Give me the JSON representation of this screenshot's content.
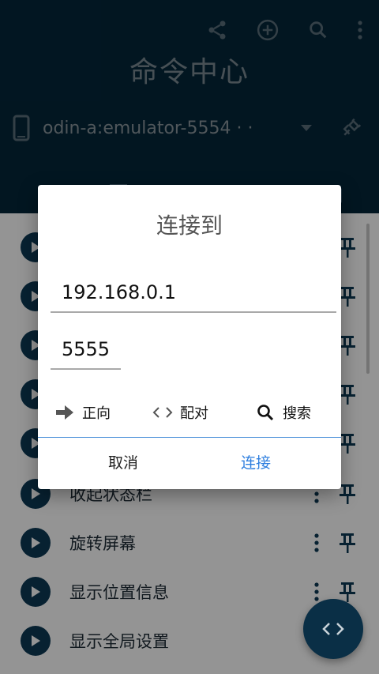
{
  "app": {
    "title": "命令中心",
    "device_name": "odin-a:emulator-5554 · ·"
  },
  "commands": [
    {
      "label": ""
    },
    {
      "label": ""
    },
    {
      "label": ""
    },
    {
      "label": ""
    },
    {
      "label": ""
    },
    {
      "label": "收起状态栏"
    },
    {
      "label": "旋转屏幕"
    },
    {
      "label": "显示位置信息"
    },
    {
      "label": "显示全局设置"
    }
  ],
  "dialog": {
    "title": "连接到",
    "ip_value": "192.168.0.1",
    "port_value": "5555",
    "option_forward": "正向",
    "option_pair": "配对",
    "option_search": "搜索",
    "cancel_label": "取消",
    "connect_label": "连接"
  },
  "colors": {
    "appbar": "#04263a",
    "accent": "#2f7fdf"
  }
}
